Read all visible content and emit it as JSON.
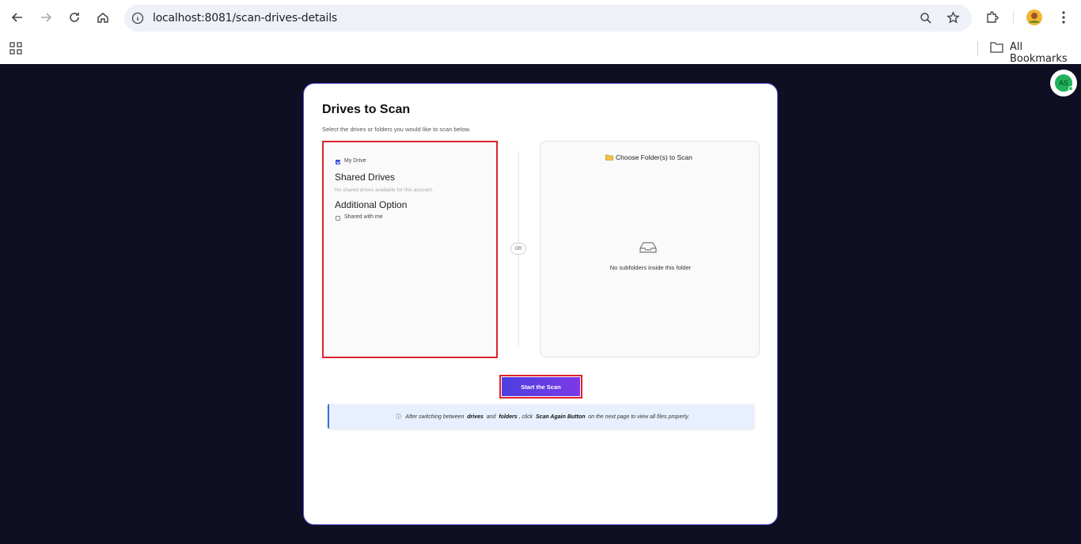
{
  "browser": {
    "url": "localhost:8081/scan-drives-details",
    "bookmarks_label": "All Bookmarks"
  },
  "user": {
    "initials": "AS"
  },
  "page": {
    "title": "Drives to Scan",
    "subtitle": "Select the drives or folders you would like to scan below.",
    "my_drive_label": "My Drive",
    "my_drive_checked": true,
    "shared_drives_heading": "Shared Drives",
    "shared_drives_empty": "No shared drives available for this account.",
    "additional_heading": "Additional Option",
    "shared_with_me_label": "Shared with me",
    "shared_with_me_checked": false,
    "or_label": "OR",
    "choose_folder_label": "Choose Folder(s) to Scan",
    "no_subfolders": "No subfolders inside this folder",
    "start_button": "Start the Scan",
    "note": {
      "part1": "After switching between",
      "drives": "drives",
      "and": "and",
      "folders": "folders",
      "click": ", click",
      "button": "Scan Again Button",
      "part2": "on the next page to view all files properly."
    }
  },
  "colors": {
    "page_bg": "#0f0f24",
    "accent": "#5b3fe3",
    "highlight": "#e0222a"
  }
}
